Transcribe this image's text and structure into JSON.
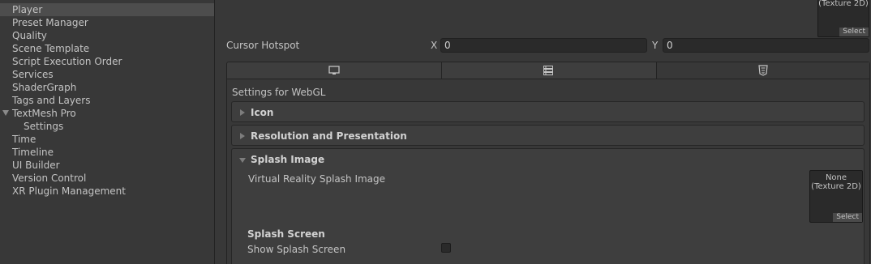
{
  "sidebar": {
    "items": [
      {
        "label": "Player",
        "selected": true
      },
      {
        "label": "Preset Manager"
      },
      {
        "label": "Quality"
      },
      {
        "label": "Scene Template"
      },
      {
        "label": "Script Execution Order"
      },
      {
        "label": "Services"
      },
      {
        "label": "ShaderGraph"
      },
      {
        "label": "Tags and Layers"
      },
      {
        "label": "TextMesh Pro",
        "expanded": true
      },
      {
        "label": "Settings",
        "child": true
      },
      {
        "label": "Time"
      },
      {
        "label": "Timeline"
      },
      {
        "label": "UI Builder"
      },
      {
        "label": "Version Control"
      },
      {
        "label": "XR Plugin Management"
      }
    ]
  },
  "cursor_texture": {
    "line": "(Texture 2D)",
    "select": "Select"
  },
  "cursor_hotspot": {
    "label": "Cursor Hotspot",
    "x_label": "X",
    "x_value": "0",
    "y_label": "Y",
    "y_value": "0"
  },
  "platform_tabs": [
    {
      "icon": "monitor-icon"
    },
    {
      "icon": "server-icon"
    },
    {
      "icon": "html5-icon",
      "active": true
    }
  ],
  "settings": {
    "title": "Settings for WebGL",
    "sections": {
      "icon": "Icon",
      "resolution": "Resolution and Presentation",
      "splash": "Splash Image"
    },
    "vr_splash": {
      "label": "Virtual Reality Splash Image",
      "line1": "None",
      "line2": "(Texture 2D)",
      "select": "Select"
    },
    "splash_screen": {
      "heading": "Splash Screen",
      "show_label": "Show Splash Screen",
      "show_checked": false
    }
  },
  "colors": {
    "background": "#383838",
    "selected_row": "#4d4d4d",
    "field_bg": "#2a2a2a",
    "text": "#c4c4c4"
  }
}
